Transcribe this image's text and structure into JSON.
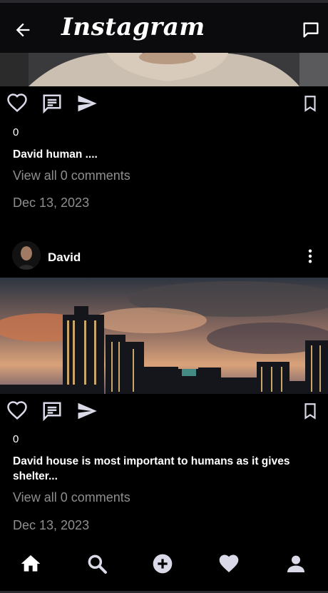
{
  "app": {
    "title": "Instagram"
  },
  "posts": [
    {
      "likes": "0",
      "caption": "David human ....",
      "comments_link": "View all 0 comments",
      "date": "Dec 13, 2023",
      "image_desc": "person-photo"
    },
    {
      "username": "David",
      "likes": "0",
      "caption": "David house is most important to humans as it gives shelter...",
      "comments_link": "View all 0 comments",
      "date": "Dec 13, 2023",
      "image_desc": "city-skyline-sunset"
    }
  ],
  "icons": {
    "back": "arrow-left-icon",
    "messages": "chat-icon",
    "like": "heart-outline-icon",
    "comment": "comment-icon",
    "share": "send-icon",
    "save": "bookmark-icon",
    "more": "more-vertical-icon"
  },
  "bottom_nav": [
    "home-icon",
    "search-icon",
    "add-icon",
    "heart-icon",
    "profile-icon"
  ],
  "colors": {
    "background": "#000000",
    "secondary_text": "#8e8e8e",
    "icon": "#d9d9e8"
  }
}
